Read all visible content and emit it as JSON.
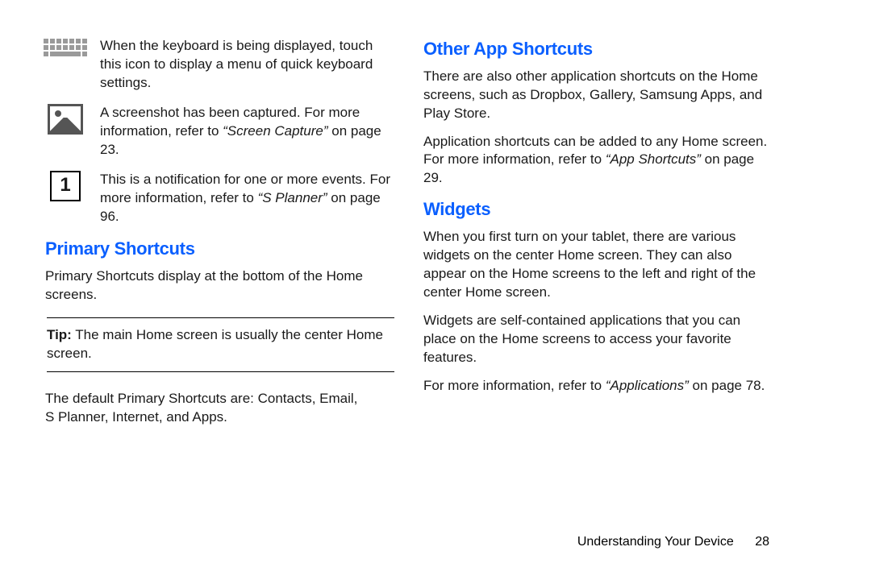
{
  "left": {
    "items": [
      {
        "text": "When the keyboard is being displayed, touch this icon to display a menu of quick keyboard settings."
      },
      {
        "text_a": "A screenshot has been captured. For more information, refer to ",
        "ref": "“Screen Capture”",
        "text_b": " on page 23."
      },
      {
        "text_a": "This is a notification for one or more events. For more information, refer to ",
        "ref": "“S Planner”",
        "text_b": " on page 96."
      }
    ],
    "primary": {
      "heading": "Primary Shortcuts",
      "p1": "Primary Shortcuts display at the bottom of the Home screens.",
      "tip_label": "Tip:",
      "tip_body": " The main Home screen is usually the center Home screen.",
      "p2": "The default Primary Shortcuts are: Contacts, Email, S Planner, Internet, and Apps."
    }
  },
  "right": {
    "other": {
      "heading": "Other App Shortcuts",
      "p1": "There are also other application shortcuts on the Home screens, such as Dropbox, Gallery, Samsung Apps, and Play Store.",
      "p2_a": "Application shortcuts can be added to any Home screen. For more information, refer to ",
      "p2_ref": "“App Shortcuts”",
      "p2_b": " on page 29."
    },
    "widgets": {
      "heading": "Widgets",
      "p1": "When you first turn on your tablet, there are various widgets on the center Home screen. They can also appear on the Home screens to the left and right of the center Home screen.",
      "p2": "Widgets are self-contained applications that you can place on the Home screens to access your favorite features.",
      "p3_a": "For more information, refer to ",
      "p3_ref": "“Applications”",
      "p3_b": " on page 78."
    }
  },
  "footer": {
    "section": "Understanding Your Device",
    "page": "28"
  }
}
